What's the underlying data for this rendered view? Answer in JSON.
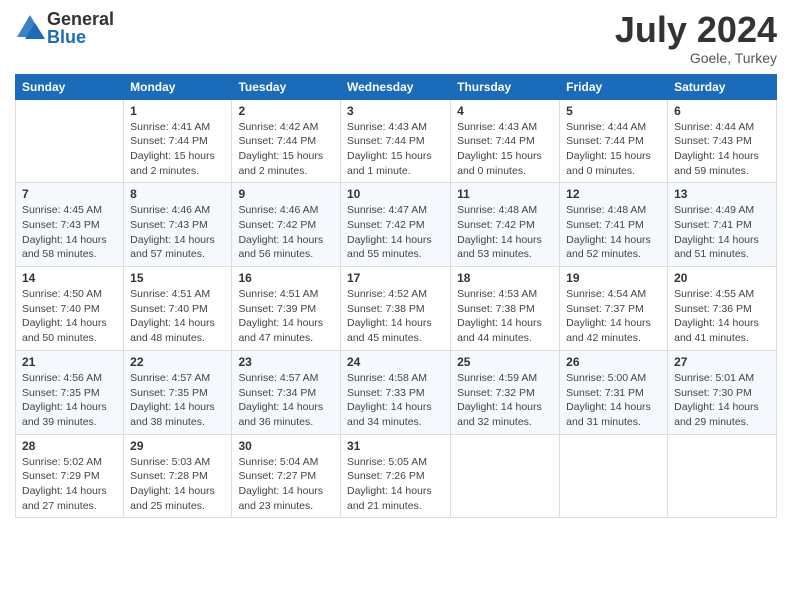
{
  "header": {
    "logo_general": "General",
    "logo_blue": "Blue",
    "month_title": "July 2024",
    "subtitle": "Goele, Turkey"
  },
  "days_of_week": [
    "Sunday",
    "Monday",
    "Tuesday",
    "Wednesday",
    "Thursday",
    "Friday",
    "Saturday"
  ],
  "weeks": [
    [
      {
        "day": "",
        "info": ""
      },
      {
        "day": "1",
        "info": "Sunrise: 4:41 AM\nSunset: 7:44 PM\nDaylight: 15 hours\nand 2 minutes."
      },
      {
        "day": "2",
        "info": "Sunrise: 4:42 AM\nSunset: 7:44 PM\nDaylight: 15 hours\nand 2 minutes."
      },
      {
        "day": "3",
        "info": "Sunrise: 4:43 AM\nSunset: 7:44 PM\nDaylight: 15 hours\nand 1 minute."
      },
      {
        "day": "4",
        "info": "Sunrise: 4:43 AM\nSunset: 7:44 PM\nDaylight: 15 hours\nand 0 minutes."
      },
      {
        "day": "5",
        "info": "Sunrise: 4:44 AM\nSunset: 7:44 PM\nDaylight: 15 hours\nand 0 minutes."
      },
      {
        "day": "6",
        "info": "Sunrise: 4:44 AM\nSunset: 7:43 PM\nDaylight: 14 hours\nand 59 minutes."
      }
    ],
    [
      {
        "day": "7",
        "info": "Sunrise: 4:45 AM\nSunset: 7:43 PM\nDaylight: 14 hours\nand 58 minutes."
      },
      {
        "day": "8",
        "info": "Sunrise: 4:46 AM\nSunset: 7:43 PM\nDaylight: 14 hours\nand 57 minutes."
      },
      {
        "day": "9",
        "info": "Sunrise: 4:46 AM\nSunset: 7:42 PM\nDaylight: 14 hours\nand 56 minutes."
      },
      {
        "day": "10",
        "info": "Sunrise: 4:47 AM\nSunset: 7:42 PM\nDaylight: 14 hours\nand 55 minutes."
      },
      {
        "day": "11",
        "info": "Sunrise: 4:48 AM\nSunset: 7:42 PM\nDaylight: 14 hours\nand 53 minutes."
      },
      {
        "day": "12",
        "info": "Sunrise: 4:48 AM\nSunset: 7:41 PM\nDaylight: 14 hours\nand 52 minutes."
      },
      {
        "day": "13",
        "info": "Sunrise: 4:49 AM\nSunset: 7:41 PM\nDaylight: 14 hours\nand 51 minutes."
      }
    ],
    [
      {
        "day": "14",
        "info": "Sunrise: 4:50 AM\nSunset: 7:40 PM\nDaylight: 14 hours\nand 50 minutes."
      },
      {
        "day": "15",
        "info": "Sunrise: 4:51 AM\nSunset: 7:40 PM\nDaylight: 14 hours\nand 48 minutes."
      },
      {
        "day": "16",
        "info": "Sunrise: 4:51 AM\nSunset: 7:39 PM\nDaylight: 14 hours\nand 47 minutes."
      },
      {
        "day": "17",
        "info": "Sunrise: 4:52 AM\nSunset: 7:38 PM\nDaylight: 14 hours\nand 45 minutes."
      },
      {
        "day": "18",
        "info": "Sunrise: 4:53 AM\nSunset: 7:38 PM\nDaylight: 14 hours\nand 44 minutes."
      },
      {
        "day": "19",
        "info": "Sunrise: 4:54 AM\nSunset: 7:37 PM\nDaylight: 14 hours\nand 42 minutes."
      },
      {
        "day": "20",
        "info": "Sunrise: 4:55 AM\nSunset: 7:36 PM\nDaylight: 14 hours\nand 41 minutes."
      }
    ],
    [
      {
        "day": "21",
        "info": "Sunrise: 4:56 AM\nSunset: 7:35 PM\nDaylight: 14 hours\nand 39 minutes."
      },
      {
        "day": "22",
        "info": "Sunrise: 4:57 AM\nSunset: 7:35 PM\nDaylight: 14 hours\nand 38 minutes."
      },
      {
        "day": "23",
        "info": "Sunrise: 4:57 AM\nSunset: 7:34 PM\nDaylight: 14 hours\nand 36 minutes."
      },
      {
        "day": "24",
        "info": "Sunrise: 4:58 AM\nSunset: 7:33 PM\nDaylight: 14 hours\nand 34 minutes."
      },
      {
        "day": "25",
        "info": "Sunrise: 4:59 AM\nSunset: 7:32 PM\nDaylight: 14 hours\nand 32 minutes."
      },
      {
        "day": "26",
        "info": "Sunrise: 5:00 AM\nSunset: 7:31 PM\nDaylight: 14 hours\nand 31 minutes."
      },
      {
        "day": "27",
        "info": "Sunrise: 5:01 AM\nSunset: 7:30 PM\nDaylight: 14 hours\nand 29 minutes."
      }
    ],
    [
      {
        "day": "28",
        "info": "Sunrise: 5:02 AM\nSunset: 7:29 PM\nDaylight: 14 hours\nand 27 minutes."
      },
      {
        "day": "29",
        "info": "Sunrise: 5:03 AM\nSunset: 7:28 PM\nDaylight: 14 hours\nand 25 minutes."
      },
      {
        "day": "30",
        "info": "Sunrise: 5:04 AM\nSunset: 7:27 PM\nDaylight: 14 hours\nand 23 minutes."
      },
      {
        "day": "31",
        "info": "Sunrise: 5:05 AM\nSunset: 7:26 PM\nDaylight: 14 hours\nand 21 minutes."
      },
      {
        "day": "",
        "info": ""
      },
      {
        "day": "",
        "info": ""
      },
      {
        "day": "",
        "info": ""
      }
    ]
  ]
}
